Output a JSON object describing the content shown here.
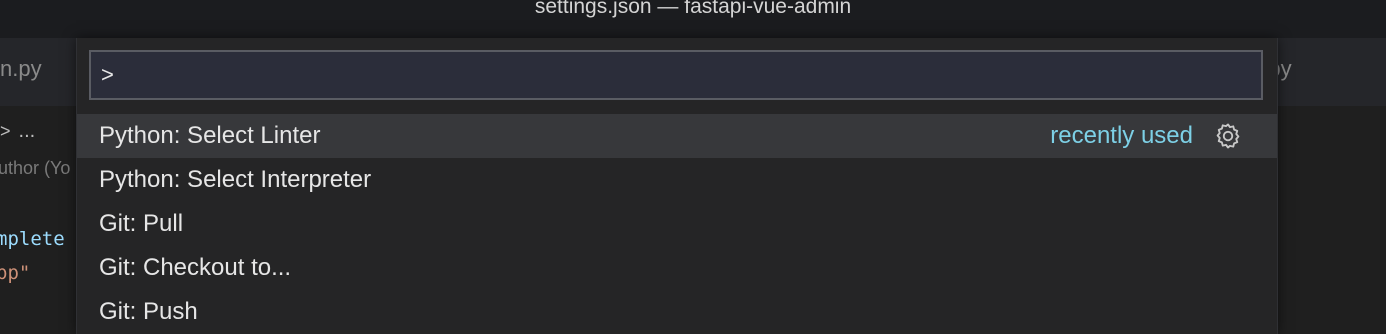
{
  "window": {
    "title": "settings.json — fastapi-vue-admin"
  },
  "background": {
    "tab_left": "n.py",
    "tab_right": "g.py",
    "breadcrumb_chevron": ">",
    "breadcrumb_more": "...",
    "blame": "uthor (Yo",
    "code_line_1": "mplete",
    "code_line_2": "pp\""
  },
  "palette": {
    "input_value": ">",
    "items": [
      {
        "label": "Python: Select Linter",
        "detail": "recently used",
        "icon": "gear-icon"
      },
      {
        "label": "Python: Select Interpreter"
      },
      {
        "label": "Git: Pull"
      },
      {
        "label": "Git: Checkout to..."
      },
      {
        "label": "Git: Push"
      }
    ]
  },
  "colors": {
    "accent_recently_used": "#7dd0e6",
    "selected_row": "#37383b",
    "palette_bg": "#252526"
  }
}
